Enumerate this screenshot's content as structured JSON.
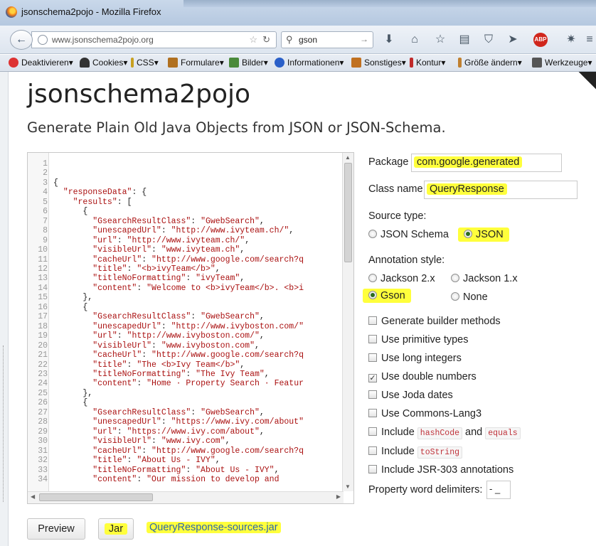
{
  "window": {
    "title": "jsonschema2pojo - Mozilla Firefox"
  },
  "toolbar": {
    "url": "www.jsonschema2pojo.org",
    "search_query": "gson",
    "abp_label": "ABP"
  },
  "bookmarks": [
    {
      "label": "Deaktivieren",
      "color": "#d33"
    },
    {
      "label": "Cookies",
      "color": "#333"
    },
    {
      "label": "CSS",
      "color": "#c8a020"
    },
    {
      "label": "Formulare",
      "color": "#b07020"
    },
    {
      "label": "Bilder",
      "color": "#4a8a3a"
    },
    {
      "label": "Informationen",
      "color": "#2a5fc8"
    },
    {
      "label": "Sonstiges",
      "color": "#c07020"
    },
    {
      "label": "Kontur",
      "color": "#c02a2a"
    },
    {
      "label": "Größe ändern",
      "color": "#c08030"
    },
    {
      "label": "Werkzeuge",
      "color": "#555"
    }
  ],
  "page": {
    "title": "jsonschema2pojo",
    "subtitle": "Generate Plain Old Java Objects from JSON or JSON-Schema."
  },
  "editor": {
    "line_numbers": "1\n2\n3\n4\n5\n6\n7\n8\n9\n10\n11\n12\n13\n14\n15\n16\n17\n18\n19\n20\n21\n22\n23\n24\n25\n26\n27\n28\n29\n30\n31\n32\n33\n34",
    "lines": [
      "",
      "",
      "{",
      "  \"responseData\": {",
      "    \"results\": [",
      "      {",
      "        \"GsearchResultClass\": \"GwebSearch\",",
      "        \"unescapedUrl\": \"http://www.ivyteam.ch/\",",
      "        \"url\": \"http://www.ivyteam.ch/\",",
      "        \"visibleUrl\": \"www.ivyteam.ch\",",
      "        \"cacheUrl\": \"http://www.google.com/search?q",
      "        \"title\": \"<b>ivyTeam</b>\",",
      "        \"titleNoFormatting\": \"ivyTeam\",",
      "        \"content\": \"Welcome to <b>ivyTeam</b>. <b>i",
      "      },",
      "      {",
      "        \"GsearchResultClass\": \"GwebSearch\",",
      "        \"unescapedUrl\": \"http://www.ivyboston.com/\"",
      "        \"url\": \"http://www.ivyboston.com/\",",
      "        \"visibleUrl\": \"www.ivyboston.com\",",
      "        \"cacheUrl\": \"http://www.google.com/search?q",
      "        \"title\": \"The <b>Ivy Team</b>\",",
      "        \"titleNoFormatting\": \"The Ivy Team\",",
      "        \"content\": \"Home · Property Search · Featur",
      "      },",
      "      {",
      "        \"GsearchResultClass\": \"GwebSearch\",",
      "        \"unescapedUrl\": \"https://www.ivy.com/about\"",
      "        \"url\": \"https://www.ivy.com/about\",",
      "        \"visibleUrl\": \"www.ivy.com\",",
      "        \"cacheUrl\": \"http://www.google.com/search?q",
      "        \"title\": \"About Us - IVY\",",
      "        \"titleNoFormatting\": \"About Us - IVY\",",
      "        \"content\": \"Our mission to develop and"
    ]
  },
  "form": {
    "package_label": "Package",
    "package_value": "com.google.generated",
    "classname_label": "Class name",
    "classname_value": "QueryResponse",
    "source_type_label": "Source type:",
    "source_json_schema": "JSON Schema",
    "source_json": "JSON",
    "annotation_label": "Annotation style:",
    "annot_jackson2": "Jackson 2.x",
    "annot_jackson1": "Jackson 1.x",
    "annot_gson": "Gson",
    "annot_none": "None",
    "opt_builder": "Generate builder methods",
    "opt_primitive": "Use primitive types",
    "opt_long": "Use long integers",
    "opt_double": "Use double numbers",
    "opt_joda": "Use Joda dates",
    "opt_commons": "Use Commons-Lang3",
    "opt_include": "Include",
    "opt_and": "and",
    "tag_hashcode": "hashCode",
    "tag_equals": "equals",
    "tag_tostring": "toString",
    "opt_jsr": "Include JSR-303 annotations",
    "delims_label": "Property word delimiters:",
    "delims_value": "- _"
  },
  "actions": {
    "preview": "Preview",
    "jar": "Jar",
    "download_link": "QueryResponse-sources.jar"
  }
}
